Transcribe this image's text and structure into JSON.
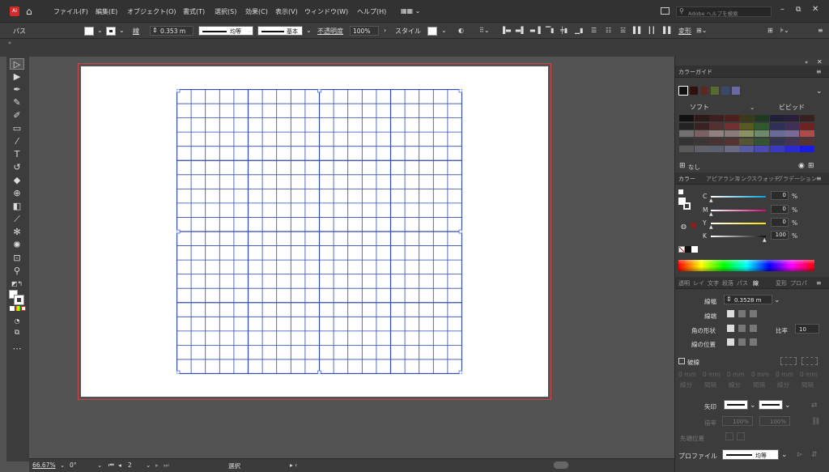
{
  "menubar": {
    "app_badge": "Ai",
    "items": [
      "ファイル(F)",
      "編集(E)",
      "オブジェクト(O)",
      "書式(T)",
      "選択(S)",
      "効果(C)",
      "表示(V)",
      "ウィンドウ(W)",
      "ヘルプ(H)"
    ],
    "search_placeholder": "Adobe ヘルプを検索"
  },
  "control": {
    "selection_type": "パス",
    "stroke_label": "線",
    "stroke_weight": "0.353 m",
    "profile_label": "均等",
    "brush_label": "基本",
    "opacity_label": "不透明度",
    "opacity_value": "100%",
    "style_label": "スタイル",
    "transform_label": "変形"
  },
  "status": {
    "zoom": "66.67%",
    "rotation": "0°",
    "artboard_number": "2",
    "mode": "選択"
  },
  "swatches_panel": {
    "title": "カラーガイド",
    "left_label": "ソフト",
    "right_label": "ビビッド",
    "none_label": "なし",
    "rows": [
      [
        "#111111",
        "#2a1a1a",
        "#3d1f1f",
        "#4d1f1f",
        "#3a3a1a",
        "#1f3a1f",
        "#1f1f3a",
        "#2a1f3a",
        "#3a1f1f"
      ],
      [
        "#222222",
        "#3a2222",
        "#553030",
        "#6e3030",
        "#585a22",
        "#2f5a2f",
        "#2f2f5a",
        "#402f5a",
        "#6e2222"
      ],
      [
        "#707070",
        "#7a6060",
        "#908080",
        "#8a7a7a",
        "#8a9060",
        "#6a8a6a",
        "#6a6a9a",
        "#7a6a9a",
        "#b04a4a"
      ],
      [
        "#333333",
        "#3d3535",
        "#4a3333",
        "#553333",
        "#555533",
        "#335533",
        "#333355",
        "#443355",
        "#553333"
      ],
      [
        "#5a5a5a",
        "#606068",
        "#5a6070",
        "#6a6a80",
        "#5a5aa0",
        "#4a4ab0",
        "#3a3ac0",
        "#2a2ad0",
        "#1a1ae0"
      ]
    ],
    "harmony": [
      "#111111",
      "#331010",
      "#5a2a22",
      "#556b2f",
      "#3a4a6a",
      "#6a6aa0"
    ]
  },
  "color_panel": {
    "tabs": [
      "カラー",
      "アピアランス",
      "リンク",
      "スウォッチ",
      "グラデーション"
    ],
    "channels": [
      {
        "label": "C",
        "value": "0",
        "unit": "%"
      },
      {
        "label": "M",
        "value": "0",
        "unit": "%"
      },
      {
        "label": "Y",
        "value": "0",
        "unit": "%"
      },
      {
        "label": "K",
        "value": "100",
        "unit": "%"
      }
    ]
  },
  "stroke_panel": {
    "tabs": [
      "透明",
      "レイ",
      "文字",
      "段落",
      "パス",
      "線",
      "変形",
      "プロパ"
    ],
    "weight_label": "線幅",
    "weight_value": "0.3528 m",
    "cap_label": "線端",
    "corner_label": "角の形状",
    "ratio_label": "比率",
    "ratio_value": "10",
    "align_label": "線の位置",
    "dashed_label": "破線",
    "dash_cells": [
      "0 mm",
      "0 mm",
      "0 mm",
      "0 mm",
      "0 mm",
      "0 mm"
    ],
    "dash_kinds": [
      "線分",
      "間隔",
      "線分",
      "間隔",
      "線分",
      "間隔"
    ],
    "arrow_label": "矢印",
    "scale_label": "倍率",
    "scale_a": "100%",
    "scale_b": "100%",
    "arrow_pos_label": "先端位置",
    "profile_label": "プロファイル",
    "profile_value": "均等"
  },
  "colors": {
    "app_bg": "#535353",
    "panel_bg": "#3c3c3c",
    "grid_line": "#2e4ab0",
    "artboard_border": "#c44444",
    "ai_badge": "#d42a2a"
  },
  "grid": {
    "columns": 20,
    "rows": 20
  }
}
